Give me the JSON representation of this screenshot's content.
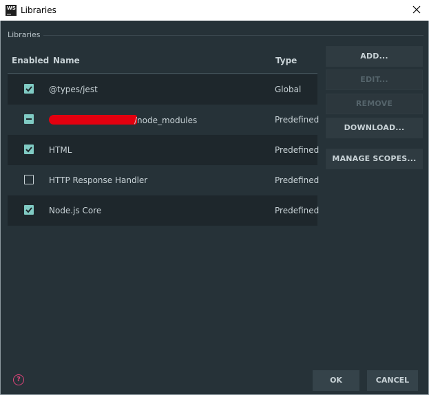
{
  "window": {
    "app_icon_text": "WS",
    "title": "Libraries"
  },
  "section": {
    "label": "Libraries"
  },
  "table": {
    "headers": {
      "enabled": "Enabled",
      "name": "Name",
      "type": "Type"
    },
    "rows": [
      {
        "state": "checked",
        "name": "@types/jest",
        "type": "Global"
      },
      {
        "state": "mixed",
        "name": "/node_modules",
        "type": "Predefined",
        "redacted_prefix": true
      },
      {
        "state": "checked",
        "name": "HTML",
        "type": "Predefined"
      },
      {
        "state": "unchecked",
        "name": "HTTP Response Handler",
        "type": "Predefined"
      },
      {
        "state": "checked",
        "name": "Node.js Core",
        "type": "Predefined"
      }
    ]
  },
  "side_buttons": {
    "add": "ADD...",
    "edit": "EDIT...",
    "remove": "REMOVE",
    "download": "DOWNLOAD...",
    "manage_scopes": "MANAGE SCOPES..."
  },
  "footer": {
    "help_icon": "?",
    "ok": "OK",
    "cancel": "CANCEL"
  },
  "colors": {
    "background": "#263238",
    "accent": "#80cbc4",
    "help": "#e0457b"
  }
}
